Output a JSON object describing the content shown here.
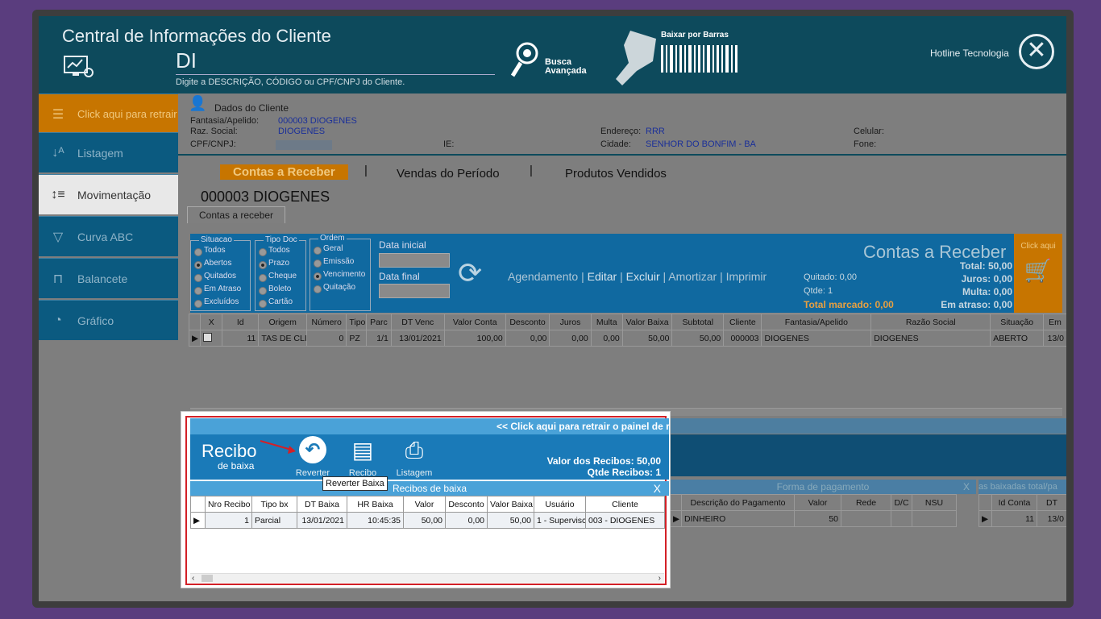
{
  "header": {
    "title": "Central de Informações do Cliente",
    "client_code": "DI",
    "hint": "Digite a DESCRIÇÃO, CÓDIGO ou CPF/CNPJ do Cliente.",
    "busca": "Busca Avançada",
    "baixar": "Baixar por Barras",
    "company": "Hotline Tecnologia"
  },
  "sidebar": {
    "retract": "Click aqui para retrair",
    "items": [
      {
        "label": "Listagem"
      },
      {
        "label": "Movimentação"
      },
      {
        "label": "Curva ABC"
      },
      {
        "label": "Balancete"
      },
      {
        "label": "Gráfico"
      }
    ]
  },
  "client": {
    "title": "Dados do Cliente",
    "fantasia_label": "Fantasia/Apelido:",
    "fantasia": "000003 DIOGENES",
    "razao_label": "Raz. Social:",
    "razao": "DIOGENES",
    "cpf_label": "CPF/CNPJ:",
    "ie_label": "IE:",
    "endereco_label": "Endereço:",
    "endereco": "RRR",
    "cidade_label": "Cidade:",
    "cidade": "SENHOR DO BONFIM - BA",
    "celular_label": "Celular:",
    "fone_label": "Fone:"
  },
  "tabs": [
    "Contas a Receber",
    "Vendas do Período",
    "Produtos Vendidos"
  ],
  "account_title": "000003 DIOGENES",
  "subtab": "Contas a receber",
  "filters": {
    "situacao": {
      "legend": "Situacao",
      "options": [
        "Todos",
        "Abertos",
        "Quitados",
        "Em Atraso",
        "Excluídos"
      ],
      "selected": 1
    },
    "tipo": {
      "legend": "Tipo Doc",
      "options": [
        "Todos",
        "Prazo",
        "Cheque",
        "Boleto",
        "Cartão"
      ],
      "selected": 1
    },
    "ordem": {
      "legend": "Ordem",
      "options": [
        "Geral",
        "Emissão",
        "Vencimento",
        "Quitação"
      ],
      "selected": 2
    },
    "data_inicial": "Data inicial",
    "data_final": "Data final"
  },
  "actions": [
    "Agendamento",
    "Editar",
    "Excluir",
    "Amortizar",
    "Imprimir"
  ],
  "summary": {
    "title": "Contas a Receber",
    "total": "Total: 50,00",
    "juros": "Juros: 0,00",
    "multa": "Multa: 0,00",
    "atraso": "Em atraso: 0,00",
    "quitado": "Quitado: 0,00",
    "qtde": "Qtde: 1",
    "marcado": "Total marcado: 0,00",
    "click": "Click aqui"
  },
  "table": {
    "headers": [
      "X",
      "Id",
      "Origem",
      "Número",
      "Tipo",
      "Parc",
      "DT Venc",
      "Valor Conta",
      "Desconto",
      "Juros",
      "Multa",
      "Valor Baixa",
      "Subtotal",
      "Cliente",
      "Fantasia/Apelido",
      "Razão Social",
      "Situação",
      "Em"
    ],
    "row": [
      "",
      "11",
      "TAS DE CLIE",
      "0",
      "PZ",
      "1/1",
      "13/01/2021",
      "100,00",
      "0,00",
      "0,00",
      "0,00",
      "50,00",
      "50,00",
      "000003",
      "DIOGENES",
      "DIOGENES",
      "ABERTO",
      "13/0"
    ]
  },
  "recibo": {
    "retract": "<< Click aqui para retrair o painel de recibo de baixa",
    "title": "Recibo",
    "subtitle": "de baixa",
    "btn_reverter": "Reverter",
    "btn_recibo": "Recibo",
    "btn_listagem": "Listagem",
    "tooltip": "Reverter Baixa",
    "valor": "Valor dos Recibos: 50,00",
    "qtde": "Qtde Recibos: 1",
    "grid_title": "Recibos de baixa",
    "headers": [
      "Nro Recibo",
      "Tipo bx",
      "DT Baixa",
      "HR Baixa",
      "Valor",
      "Desconto",
      "Valor Baixa",
      "Usuário",
      "Cliente"
    ],
    "row": [
      "1",
      "Parcial",
      "13/01/2021",
      "10:45:35",
      "50,00",
      "0,00",
      "50,00",
      "1 - Supervisc",
      "003 - DIOGENES"
    ]
  },
  "pagamento": {
    "title": "Forma de pagamento",
    "headers": [
      "Descrição do Pagamento",
      "Valor",
      "Rede",
      "D/C",
      "NSU"
    ],
    "row": [
      "DINHEIRO",
      "50",
      "",
      "",
      ""
    ]
  },
  "baixadas": {
    "title": "as baixadas total/pa",
    "headers": [
      "Id Conta",
      "DT"
    ],
    "row": [
      "11",
      "13/0"
    ]
  }
}
